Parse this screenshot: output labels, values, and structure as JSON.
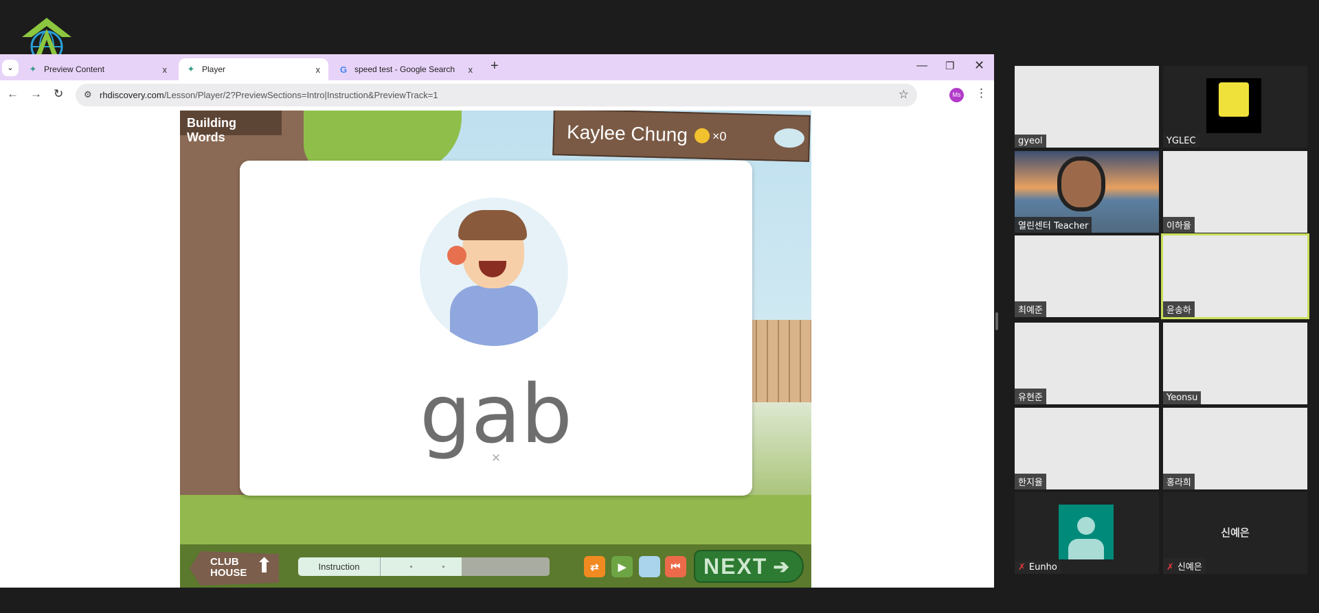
{
  "browser": {
    "tabs": [
      {
        "label": "Preview Content",
        "icon": "butterfly-icon",
        "active": false
      },
      {
        "label": "Player",
        "icon": "butterfly-icon",
        "active": true
      },
      {
        "label": "speed test - Google Search",
        "icon": "google-icon",
        "active": false
      }
    ],
    "close_glyph": "x",
    "new_tab_glyph": "+",
    "url_host": "rhdiscovery.com",
    "url_path": "/Lesson/Player/2?PreviewSections=Intro|Instruction&PreviewTrack=1",
    "profile_initials": "Ms",
    "profile_color": "#b23bc9",
    "tab_bar_color": "#e8d3f8"
  },
  "game": {
    "section_title": "Building Words",
    "student_name": "Kaylee Chung",
    "coin_count": "×0",
    "word": "gab",
    "dismiss_glyph": "×",
    "clubhouse_label_1": "CLUB",
    "clubhouse_label_2": "HOUSE",
    "progress_label": "Instruction",
    "next_label": "NEXT",
    "next_glyph": "➔"
  },
  "participants": [
    {
      "name": "gyeol",
      "video": "blank"
    },
    {
      "name": "YGLEC",
      "video": "spongebob"
    },
    {
      "name": "열린센터 Teacher",
      "video": "teacher"
    },
    {
      "name": "이하율",
      "video": "blank"
    },
    {
      "name": "최예준",
      "video": "blank"
    },
    {
      "name": "윤송하",
      "video": "blank",
      "active_speaker": true
    },
    {
      "name": "유현준",
      "video": "blank"
    },
    {
      "name": "Yeonsu",
      "video": "blank"
    },
    {
      "name": "한지율",
      "video": "blank"
    },
    {
      "name": "홍라희",
      "video": "blank"
    },
    {
      "name": "Eunho",
      "video": "avatar",
      "muted": true
    },
    {
      "name": "신예은",
      "video": "off",
      "muted": true
    }
  ],
  "mute_glyph": "✗"
}
